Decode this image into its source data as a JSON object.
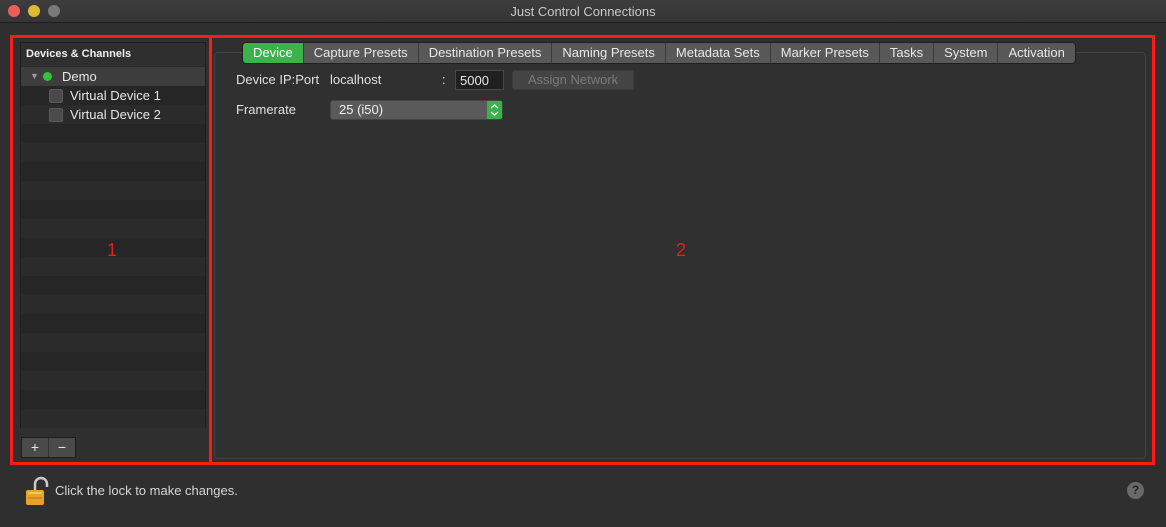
{
  "window": {
    "title": "Just Control Connections"
  },
  "sidebar": {
    "header": "Devices & Channels",
    "items": [
      {
        "label": "Demo",
        "status": "connected",
        "status_color": "#35c13a"
      },
      {
        "label": "Virtual Device 1",
        "checked": false
      },
      {
        "label": "Virtual Device 2",
        "checked": false
      }
    ],
    "add_label": "+",
    "remove_label": "−"
  },
  "tabs": [
    "Device",
    "Capture Presets",
    "Destination Presets",
    "Naming Presets",
    "Metadata Sets",
    "Marker Presets",
    "Tasks",
    "System",
    "Activation"
  ],
  "active_tab": "Device",
  "device": {
    "ip_label": "Device IP:Port",
    "ip_value": "localhost",
    "separator": ":",
    "port_value": "5000",
    "assign_button": "Assign Network",
    "framerate_label": "Framerate",
    "framerate_value": "25 (i50)"
  },
  "annotations": {
    "left": "1",
    "right": "2",
    "color": "#ff1a1a"
  },
  "footer": {
    "lock_text": "Click the lock to make changes.",
    "help_label": "?"
  },
  "colors": {
    "accent": "#3ab34a",
    "background": "#2f2f2f"
  }
}
